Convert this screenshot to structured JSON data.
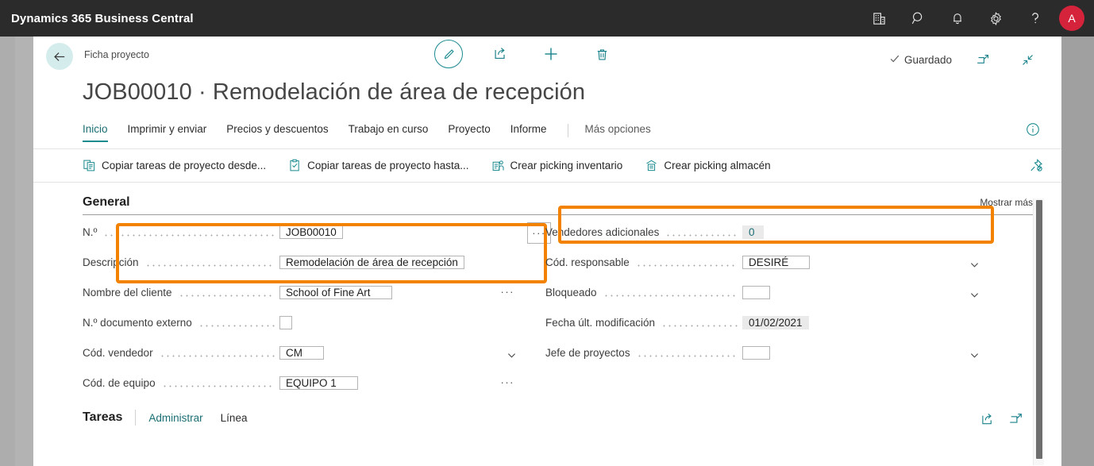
{
  "topbar": {
    "brand": "Dynamics 365 Business Central",
    "icons": [
      "company-icon",
      "search-icon",
      "notification-bell-icon",
      "settings-gear-icon",
      "help-question-icon"
    ],
    "avatar_initial": "A",
    "avatar_color": "#d6233c"
  },
  "header": {
    "back_label": "back-arrow",
    "breadcrumb": "Ficha proyecto",
    "actions": [
      "edit-pencil-icon",
      "share-icon",
      "new-plus-icon",
      "delete-trash-icon"
    ],
    "status": "Guardado",
    "right_icons": [
      "open-in-new-window-icon",
      "collapse-icon"
    ]
  },
  "page_title": "JOB00010 · Remodelación de área de recepción",
  "menu": {
    "items": [
      {
        "label": "Inicio",
        "active": true
      },
      {
        "label": "Imprimir y enviar",
        "active": false
      },
      {
        "label": "Precios y descuentos",
        "active": false
      },
      {
        "label": "Trabajo en curso",
        "active": false
      },
      {
        "label": "Proyecto",
        "active": false
      },
      {
        "label": "Informe",
        "active": false
      }
    ],
    "more": "Más opciones",
    "info_icon": "info-circle-icon"
  },
  "commandbar": {
    "buttons": [
      {
        "label": "Copiar tareas de proyecto desde...",
        "icon": "copy-from-icon"
      },
      {
        "label": "Copiar tareas de proyecto hasta...",
        "icon": "copy-to-icon"
      },
      {
        "label": "Crear picking inventario",
        "icon": "inventory-pick-icon"
      },
      {
        "label": "Crear picking almacén",
        "icon": "warehouse-pick-icon"
      }
    ],
    "pin_icon": "unpin-icon"
  },
  "general": {
    "section_title": "General",
    "show_more": "Mostrar más",
    "left_fields": [
      {
        "label": "N.º",
        "value": "JOB00010",
        "type": "text-with-external-ellipsis",
        "placeholder": ""
      },
      {
        "label": "Descripción",
        "value": "Remodelación de área de recepción",
        "type": "text",
        "placeholder": ""
      },
      {
        "label": "Nombre del cliente",
        "value": "School of Fine Art",
        "type": "lookup",
        "placeholder": ""
      },
      {
        "label": "N.º documento externo",
        "value": "",
        "type": "text",
        "placeholder": ""
      },
      {
        "label": "Cód. vendedor",
        "value": "CM",
        "type": "dropdown",
        "placeholder": ""
      },
      {
        "label": "Cód. de equipo",
        "value": "EQUIPO 1",
        "type": "lookup",
        "placeholder": ""
      }
    ],
    "right_fields": [
      {
        "label": "Vendedores adicionales",
        "value": "0",
        "type": "readonly-number",
        "placeholder": ""
      },
      {
        "label": "Cód. responsable",
        "value": "DESIRÉ",
        "type": "dropdown",
        "placeholder": ""
      },
      {
        "label": "Bloqueado",
        "value": "",
        "type": "dropdown",
        "placeholder": ""
      },
      {
        "label": "Fecha últ. modificación",
        "value": "01/02/2021",
        "type": "readonly",
        "placeholder": ""
      },
      {
        "label": "Jefe de proyectos",
        "value": "",
        "type": "dropdown",
        "placeholder": ""
      }
    ]
  },
  "highlights": {
    "color": "#f28200",
    "boxes": [
      "vendedores-adicionales-field",
      "cod-vendedor-and-cod-equipo-fields"
    ]
  },
  "tasks": {
    "title": "Tareas",
    "links": [
      "Administrar",
      "Línea"
    ],
    "icons": [
      "share-icon",
      "open-in-new-window-icon"
    ]
  }
}
